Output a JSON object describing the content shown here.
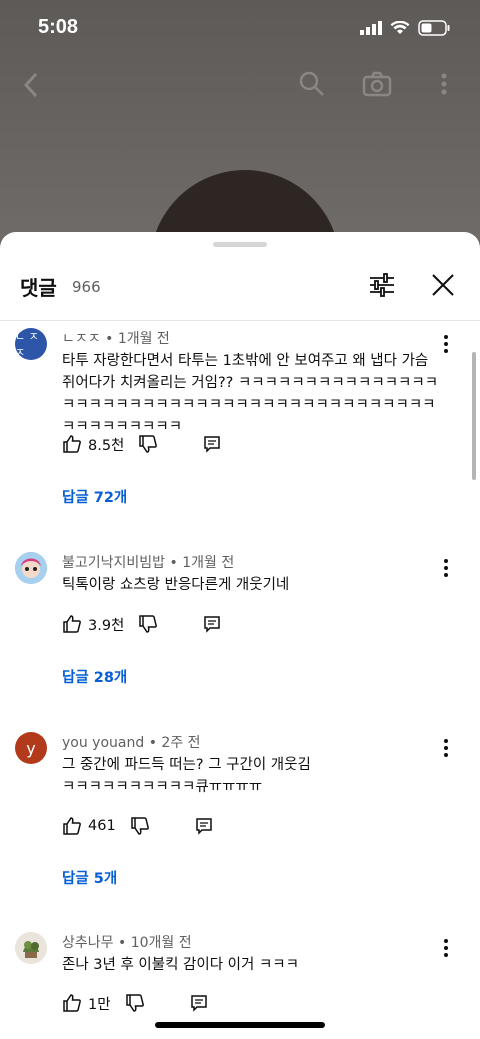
{
  "status": {
    "time": "5:08"
  },
  "sheet": {
    "title": "댓글",
    "count": "966"
  },
  "comments": [
    {
      "author": "ㄴㅈㅈ",
      "age": "1개월 전",
      "avatar_text": "ㄴ ㅈㅈ",
      "text": "타투 자랑한다면서 타투는 1초밖에 안 보여주고 왜 냅다 가슴 쥐어다가 치켜올리는 거임?? ㅋㅋㅋㅋㅋㅋㅋㅋㅋㅋㅋㅋㅋㅋㅋㅋㅋㅋㅋㅋㅋㅋㅋㅋㅋㅋㅋㅋㅋㅋㅋㅋㅋㅋㅋㅋㅋㅋㅋㅋㅋㅋㅋㅋㅋㅋㅋㅋㅋㅋㅋㅋ",
      "likes": "8.5천",
      "replies": "답글 72개"
    },
    {
      "author": "불고기낙지비빔밥",
      "age": "1개월 전",
      "avatar_text": "",
      "text": "틱톡이랑 쇼츠랑 반응다른게 개웃기네",
      "likes": "3.9천",
      "replies": "답글 28개"
    },
    {
      "author": "you youand",
      "age": "2주 전",
      "avatar_text": "y",
      "text": "그 중간에 파드득 떠는? 그 구간이 개웃김\nㅋㅋㅋㅋㅋㅋㅋㅋㅋㅋ큐ㅠㅠㅠㅠ",
      "likes": "461",
      "replies": "답글 5개"
    },
    {
      "author": "상추나무",
      "age": "10개월 전",
      "avatar_text": "",
      "text": "존나 3년 후 이불킥 감이다 이거 ㅋㅋㅋ",
      "likes": "1만",
      "replies": ""
    }
  ],
  "colors": {
    "link": "#065fd4",
    "avatar_1": "#2d56a8",
    "avatar_3": "#b23a1a"
  }
}
